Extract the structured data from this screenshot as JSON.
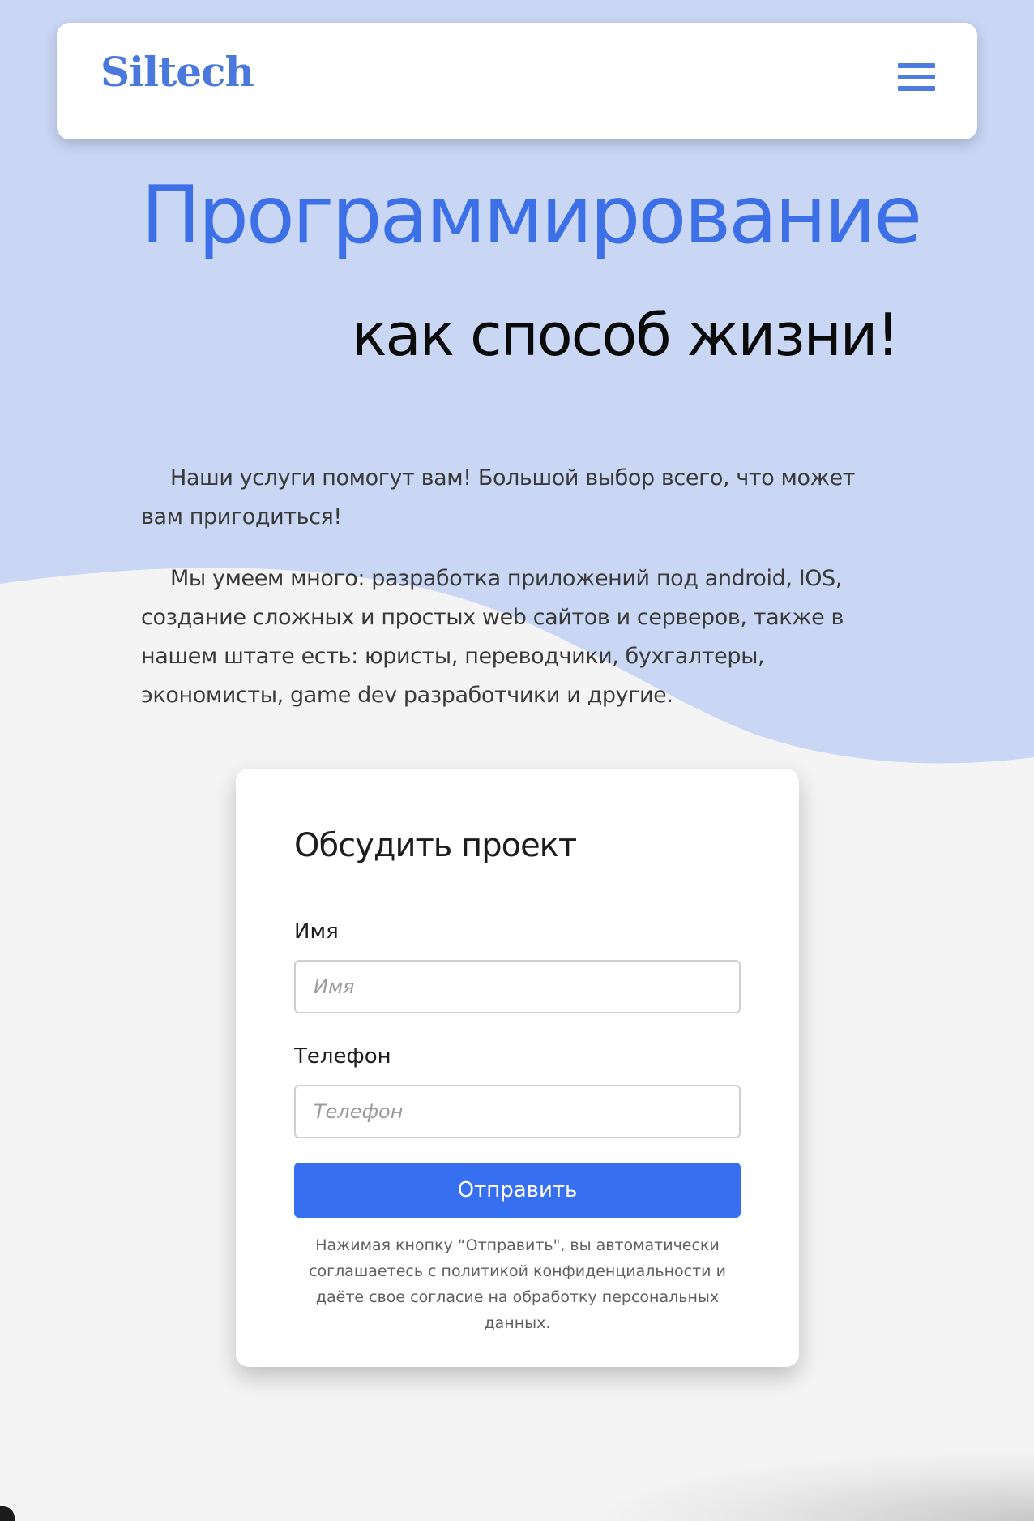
{
  "colors": {
    "hero_background": "#c9d6f4",
    "page_background": "#f4f4f4",
    "accent": "#3d6fe6",
    "button": "#3670f0"
  },
  "header": {
    "logo": "Siltech",
    "menu_icon": "hamburger-menu-icon"
  },
  "hero": {
    "title": "Программирование",
    "subtitle": "как способ жизни!"
  },
  "about": {
    "paragraph_1": "Наши услуги помогут вам! Большой выбор всего, что может вам пригодиться!",
    "paragraph_2": "Мы умеем много: разработка приложений под android, IOS, создание сложных и простых web сайтов и серверов, также в нашем штате есть: юристы, переводчики, бухгалтеры, экономисты, game dev разработчики и другие."
  },
  "form": {
    "title": "Обсудить проект",
    "name_label": "Имя",
    "name_placeholder": "Имя",
    "phone_label": "Телефон",
    "phone_placeholder": "Телефон",
    "submit_label": "Отправить",
    "disclaimer": "Нажимая кнопку “Отправить\", вы автоматически соглашаетесь с политикой конфиденциальности и даёте свое согласие на обработку персональных данных."
  }
}
